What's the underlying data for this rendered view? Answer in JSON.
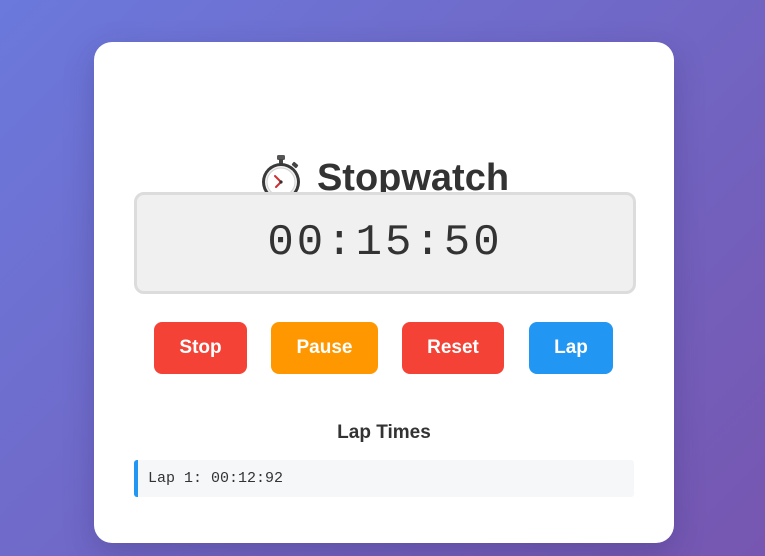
{
  "app": {
    "title": "Stopwatch",
    "title_icon": "stopwatch-icon"
  },
  "display": {
    "time": "00:15:50"
  },
  "controls": {
    "stop_label": "Stop",
    "pause_label": "Pause",
    "reset_label": "Reset",
    "lap_label": "Lap"
  },
  "laps": {
    "heading": "Lap Times",
    "items": [
      {
        "label": "Lap 1: 00:12:92"
      }
    ]
  },
  "colors": {
    "stop": "#f44336",
    "pause": "#ff9800",
    "reset": "#f44336",
    "lap": "#2196f3",
    "background_start": "#6b79dc",
    "background_end": "#7656b0"
  }
}
